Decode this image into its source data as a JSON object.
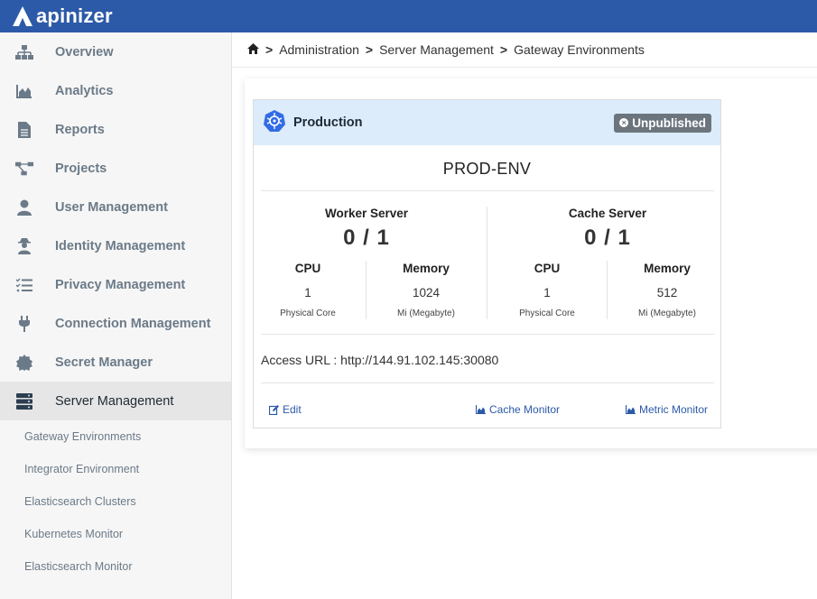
{
  "brand": {
    "name": "apinizer"
  },
  "sidebar": {
    "items": [
      {
        "label": "Overview",
        "icon": "sitemap-icon"
      },
      {
        "label": "Analytics",
        "icon": "area-chart-icon"
      },
      {
        "label": "Reports",
        "icon": "file-icon"
      },
      {
        "label": "Projects",
        "icon": "project-diagram-icon"
      },
      {
        "label": "User Management",
        "icon": "user-icon"
      },
      {
        "label": "Identity Management",
        "icon": "user-secret-icon"
      },
      {
        "label": "Privacy Management",
        "icon": "tasks-icon"
      },
      {
        "label": "Connection Management",
        "icon": "plug-icon"
      },
      {
        "label": "Secret Manager",
        "icon": "certificate-icon"
      },
      {
        "label": "Server Management",
        "icon": "server-icon",
        "active": true
      }
    ],
    "sub_items": [
      {
        "label": "Gateway Environments"
      },
      {
        "label": "Integrator Environment"
      },
      {
        "label": "Elasticsearch Clusters"
      },
      {
        "label": "Kubernetes Monitor"
      },
      {
        "label": "Elasticsearch Monitor"
      }
    ]
  },
  "breadcrumb": {
    "items": [
      "Administration",
      "Server Management",
      "Gateway Environments"
    ],
    "separator": ">"
  },
  "card": {
    "title": "Production",
    "badge": "Unpublished",
    "env_name": "PROD-ENV",
    "worker": {
      "title": "Worker Server",
      "count": "0 / 1",
      "cpu_label": "CPU",
      "cpu_value": "1",
      "cpu_unit": "Physical Core",
      "mem_label": "Memory",
      "mem_value": "1024",
      "mem_unit": "Mi (Megabyte)"
    },
    "cache": {
      "title": "Cache Server",
      "count": "0 / 1",
      "cpu_label": "CPU",
      "cpu_value": "1",
      "cpu_unit": "Physical Core",
      "mem_label": "Memory",
      "mem_value": "512",
      "mem_unit": "Mi (Megabyte)"
    },
    "access_url": "Access URL : http://144.91.102.145:30080",
    "actions": {
      "edit": "Edit",
      "cache_monitor": "Cache Monitor",
      "metric_monitor": "Metric Monitor"
    }
  },
  "colors": {
    "topbar": "#2c5aa8",
    "card_header": "#dcecfa",
    "badge": "#6c757d",
    "link": "#2c5aa8"
  }
}
